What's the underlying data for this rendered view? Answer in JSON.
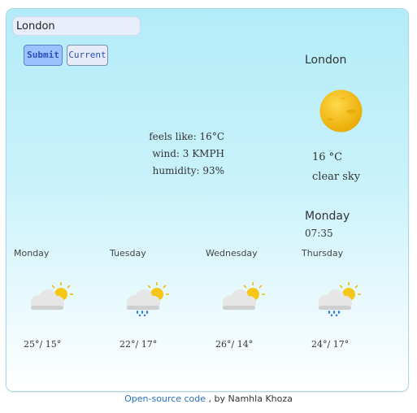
{
  "search": {
    "value": "London"
  },
  "buttons": {
    "submit_label": "Submit",
    "current_label": "Current"
  },
  "current": {
    "city": "London",
    "icon": "sun-icon",
    "temperature": "16 °C",
    "description": "clear sky",
    "feels_like": "feels like: 16°C",
    "wind": "wind: 3 KMPH",
    "humidity": "humidity: 93%",
    "day": "Monday",
    "time": "07:35"
  },
  "forecast": [
    {
      "day": "Monday",
      "icon": "partly-cloudy-icon",
      "temps": "25°/ 15°"
    },
    {
      "day": "Tuesday",
      "icon": "rain-cloud-icon",
      "temps": "22°/ 17°"
    },
    {
      "day": "Wednesday",
      "icon": "partly-cloudy-icon",
      "temps": "26°/ 14°"
    },
    {
      "day": "Thursday",
      "icon": "rain-cloud-icon",
      "temps": "24°/ 17°"
    }
  ],
  "footer": {
    "link_text": "Open-source code",
    "suffix": ", by Namhla Khoza"
  },
  "colors": {
    "card_top": "#b2ecf8",
    "sun": "#f5c518",
    "submit_bg": "#9cc2ff",
    "link": "#2a6fbf"
  }
}
